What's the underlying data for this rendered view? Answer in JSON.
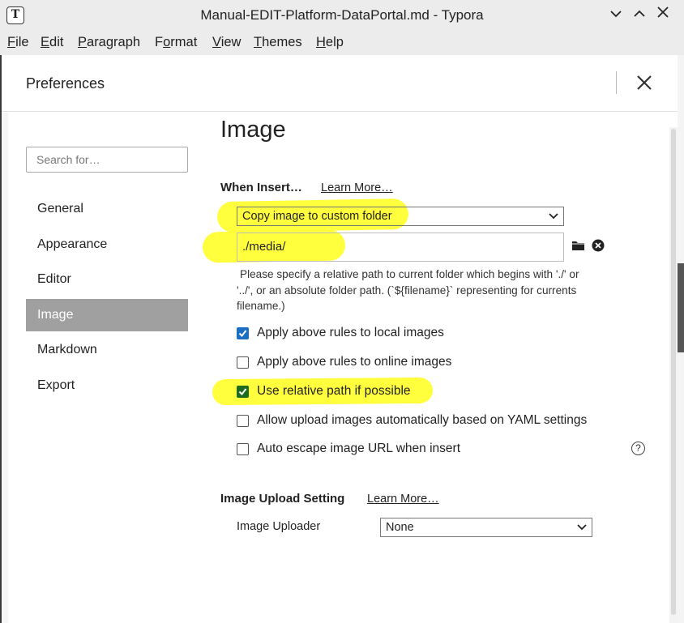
{
  "window": {
    "title": "Manual-EDIT-Platform-DataPortal.md - Typora",
    "icon_letter": "T"
  },
  "menu": [
    {
      "label": "File",
      "key": "F"
    },
    {
      "label": "Edit",
      "key": "E"
    },
    {
      "label": "Paragraph",
      "key": "P"
    },
    {
      "label": "Format",
      "key": "o"
    },
    {
      "label": "View",
      "key": "V"
    },
    {
      "label": "Themes",
      "key": "T"
    },
    {
      "label": "Help",
      "key": "H"
    }
  ],
  "dialog": {
    "title": "Preferences",
    "search_placeholder": "Search for…",
    "nav": [
      "General",
      "Appearance",
      "Editor",
      "Image",
      "Markdown",
      "Export"
    ],
    "active_nav": "Image"
  },
  "image_page": {
    "title": "Image",
    "when_insert_label": "When Insert…",
    "learn_more": "Learn More…",
    "insert_action": "Copy image to custom folder",
    "folder_path": "./media/",
    "hint_lines": [
      "Please specify a relative path to current folder which begins with './' or",
      "'../', or an absolute folder path. (`${filename}` representing for currents",
      "filename.)"
    ],
    "options": [
      {
        "label": "Apply above rules to local images",
        "checked": true
      },
      {
        "label": "Apply above rules to online images",
        "checked": false
      },
      {
        "label": "Use relative path if possible",
        "checked": true
      },
      {
        "label": "Allow upload images automatically based on YAML settings",
        "checked": false
      },
      {
        "label": "Auto escape image URL when insert",
        "checked": false
      }
    ],
    "upload_section_label": "Image Upload Setting",
    "upload_learn_more": "Learn More…",
    "uploader_label": "Image Uploader",
    "uploader_value": "None",
    "help_glyph": "?"
  },
  "colors": {
    "highlight": "#ffff33",
    "active_nav_bg": "#a0a0a0",
    "checkbox_blue": "#1a6fc4",
    "checkbox_green": "#1d6b20"
  }
}
